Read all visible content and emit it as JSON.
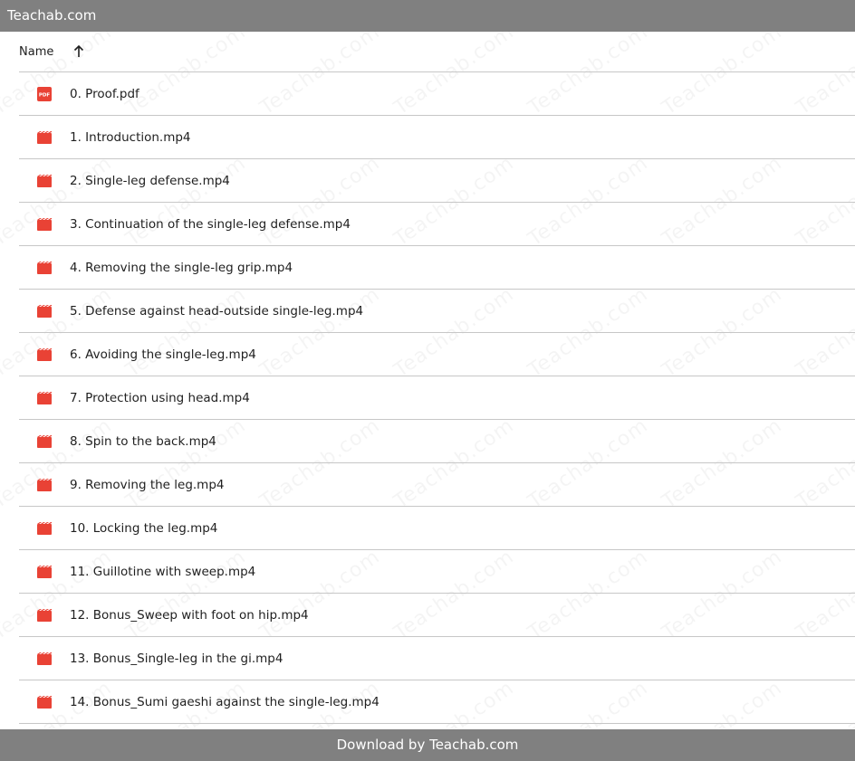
{
  "topbar": {
    "title": "Teachab.com"
  },
  "header": {
    "name_label": "Name"
  },
  "files": [
    {
      "name": "0. Proof.pdf",
      "icon": "pdf-icon"
    },
    {
      "name": "1. Introduction.mp4",
      "icon": "video-icon"
    },
    {
      "name": "2. Single-leg defense.mp4",
      "icon": "video-icon"
    },
    {
      "name": "3. Continuation of the single-leg defense.mp4",
      "icon": "video-icon"
    },
    {
      "name": "4. Removing the single-leg grip.mp4",
      "icon": "video-icon"
    },
    {
      "name": "5. Defense against head-outside single-leg.mp4",
      "icon": "video-icon"
    },
    {
      "name": "6. Avoiding the single-leg.mp4",
      "icon": "video-icon"
    },
    {
      "name": "7. Protection using head.mp4",
      "icon": "video-icon"
    },
    {
      "name": "8. Spin to the back.mp4",
      "icon": "video-icon"
    },
    {
      "name": "9. Removing the leg.mp4",
      "icon": "video-icon"
    },
    {
      "name": "10. Locking the leg.mp4",
      "icon": "video-icon"
    },
    {
      "name": "11. Guillotine with sweep.mp4",
      "icon": "video-icon"
    },
    {
      "name": "12. Bonus_Sweep with foot on hip.mp4",
      "icon": "video-icon"
    },
    {
      "name": "13. Bonus_Single-leg in the gi.mp4",
      "icon": "video-icon"
    },
    {
      "name": "14. Bonus_Sumi gaeshi against the single-leg.mp4",
      "icon": "video-icon"
    }
  ],
  "pdf_icon_text": "PDF",
  "watermark_text": "Teachab.com",
  "footer": {
    "text": "Download by Teachab.com"
  },
  "colors": {
    "bar": "#808080",
    "icon_red": "#e94235",
    "divider": "#c7c7c7"
  }
}
